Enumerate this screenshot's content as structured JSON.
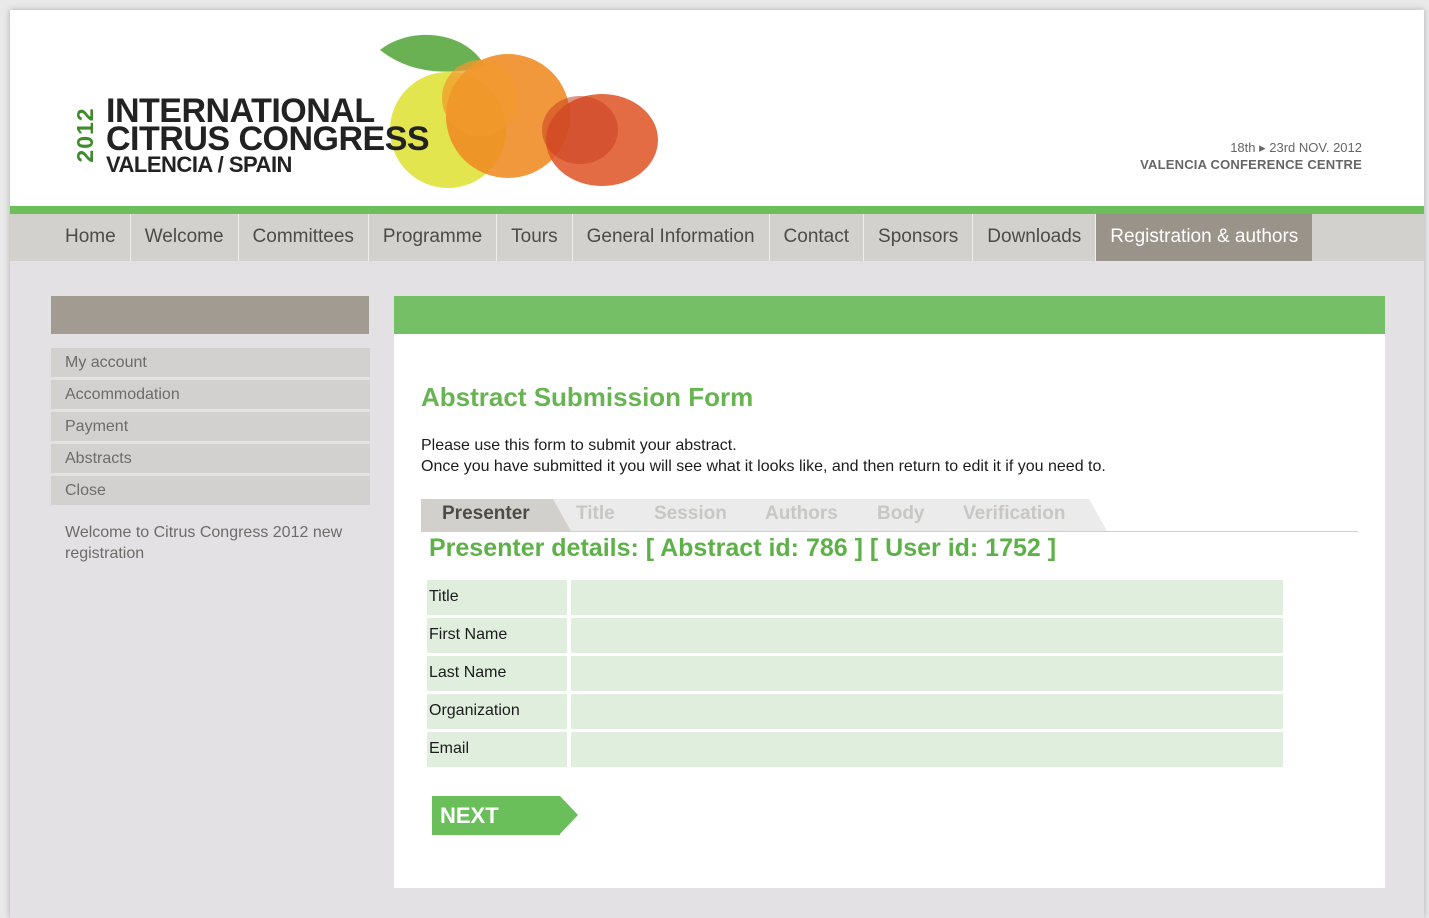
{
  "header": {
    "logo_year": "2012",
    "logo_line1": "INTERNATIONAL",
    "logo_line2": "CITRUS CONGRESS",
    "logo_line3": "VALENCIA / SPAIN",
    "event_dates": "18th ▸ 23rd  NOV. 2012",
    "event_venue": "VALENCIA CONFERENCE CENTRE"
  },
  "nav": {
    "items": [
      "Home",
      "Welcome",
      "Committees",
      "Programme",
      "Tours",
      "General Information",
      "Contact",
      "Sponsors",
      "Downloads",
      "Registration & authors"
    ],
    "active_index": 9
  },
  "sidebar": {
    "items": [
      "My account",
      "Accommodation",
      "Payment",
      "Abstracts",
      "Close"
    ],
    "welcome": "Welcome to Citrus Congress 2012 new registration"
  },
  "form": {
    "title": "Abstract Submission Form",
    "intro_line1": "Please use this form to submit your abstract.",
    "intro_line2": "Once you have submitted it you will see what it looks like, and then return to edit it if you need to.",
    "tabs": [
      "Presenter",
      "Title",
      "Session",
      "Authors",
      "Body",
      "Verification"
    ],
    "active_tab": 0,
    "presenter_heading": "Presenter details: [ Abstract id: 786 ] [ User id: 1752 ]",
    "fields": [
      {
        "label": "Title",
        "value": ""
      },
      {
        "label": "First Name",
        "value": ""
      },
      {
        "label": "Last Name",
        "value": ""
      },
      {
        "label": "Organization",
        "value": ""
      },
      {
        "label": "Email",
        "value": ""
      }
    ],
    "next_label": "NEXT"
  },
  "colors": {
    "brand_green": "#6bbf5a",
    "nav_active": "#9a938a",
    "field_bg": "#dfeedd"
  }
}
